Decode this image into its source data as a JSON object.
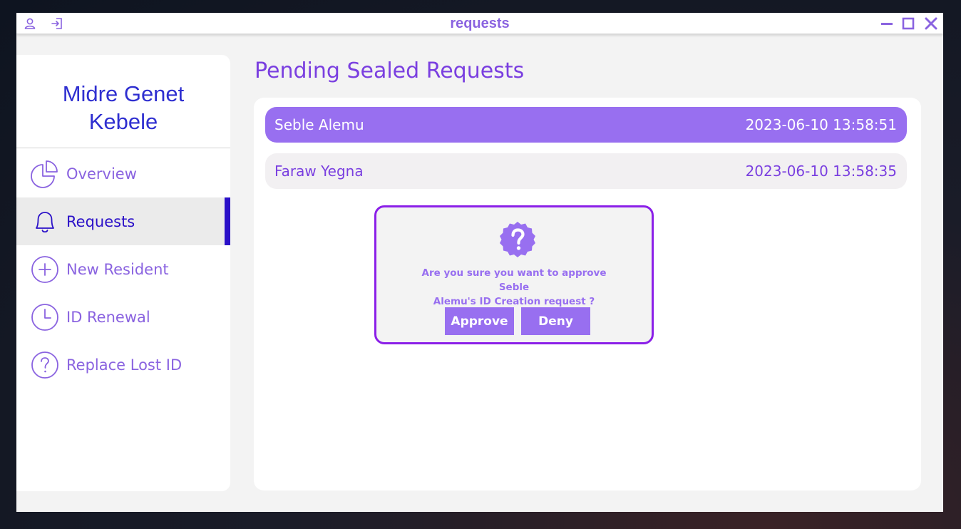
{
  "window": {
    "title": "requests",
    "icons": [
      "user-icon",
      "logout-icon",
      "minimize-icon",
      "maximize-icon",
      "close-icon"
    ]
  },
  "sidebar": {
    "brand_line1": "Midre Genet",
    "brand_line2": "Kebele",
    "items": [
      {
        "label": "Overview",
        "icon": "pie-chart-icon",
        "active": false
      },
      {
        "label": "Requests",
        "icon": "bell-icon",
        "active": true
      },
      {
        "label": "New Resident",
        "icon": "plus-circle-icon",
        "active": false
      },
      {
        "label": "ID Renewal",
        "icon": "clock-icon",
        "active": false
      },
      {
        "label": "Replace Lost ID",
        "icon": "help-circle-icon",
        "active": false
      }
    ]
  },
  "main": {
    "title": "Pending Sealed Requests",
    "requests": [
      {
        "name": "Seble Alemu",
        "timestamp": "2023-06-10 13:58:51",
        "selected": true
      },
      {
        "name": "Faraw Yegna",
        "timestamp": "2023-06-10 13:58:35",
        "selected": false
      }
    ]
  },
  "dialog": {
    "icon": "question-badge-icon",
    "message_line1": "Are you sure you want to approve Seble",
    "message_line2": "Alemu's ID Creation request ?",
    "approve_label": "Approve",
    "deny_label": "Deny"
  },
  "colors": {
    "accent": "#986ff0",
    "accent_text": "#8a63e0",
    "active_nav": "#2a10c8",
    "brand": "#2f2fd0",
    "dialog_border": "#8b1fe8"
  }
}
